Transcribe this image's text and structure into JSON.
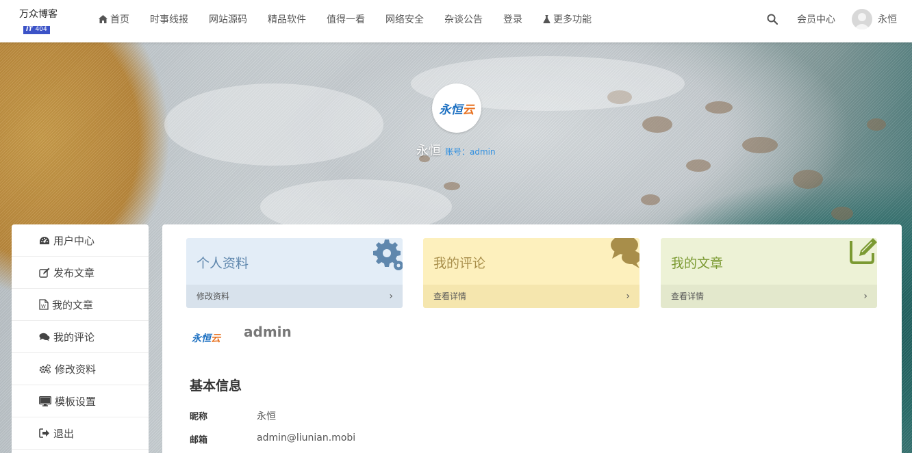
{
  "logo": {
    "line1": "万众博客",
    "badge_it": "IT",
    "badge_num": "404"
  },
  "nav": {
    "items": [
      {
        "label": "首页",
        "icon": "home-icon"
      },
      {
        "label": "时事线报"
      },
      {
        "label": "网站源码"
      },
      {
        "label": "精品软件"
      },
      {
        "label": "值得一看"
      },
      {
        "label": "网络安全"
      },
      {
        "label": "杂谈公告"
      },
      {
        "label": "登录"
      },
      {
        "label": "更多功能",
        "icon": "flask-icon"
      }
    ],
    "member_center": "会员中心",
    "username": "永恒"
  },
  "profile": {
    "brand": {
      "c1": "永",
      "c2": "恒",
      "c3": "云"
    },
    "name": "永恒",
    "account_label": "账号：",
    "account": "admin"
  },
  "sidebar": {
    "items": [
      {
        "label": "用户中心",
        "icon": "dashboard-icon"
      },
      {
        "label": "发布文章",
        "icon": "edit-icon"
      },
      {
        "label": "我的文章",
        "icon": "word-file-icon"
      },
      {
        "label": "我的评论",
        "icon": "comments-icon"
      },
      {
        "label": "修改资料",
        "icon": "gears-icon"
      },
      {
        "label": "模板设置",
        "icon": "desktop-icon"
      },
      {
        "label": "退出",
        "icon": "sign-out-icon"
      }
    ]
  },
  "cards": [
    {
      "title": "个人资料",
      "link": "修改资料",
      "chevron": "›",
      "icon": "cogs-icon",
      "color": "#5f87ad"
    },
    {
      "title": "我的评论",
      "link": "查看详情",
      "chevron": "›",
      "icon": "comments-icon",
      "color": "#a88e4a"
    },
    {
      "title": "我的文章",
      "link": "查看详情",
      "chevron": "›",
      "icon": "pencil-square-icon",
      "color": "#7b9a32"
    }
  ],
  "user": {
    "account": "admin"
  },
  "basic_info": {
    "title": "基本信息",
    "rows": [
      {
        "label": "昵称",
        "value": "永恒"
      },
      {
        "label": "邮箱",
        "value": "admin@liunian.mobi"
      }
    ]
  }
}
